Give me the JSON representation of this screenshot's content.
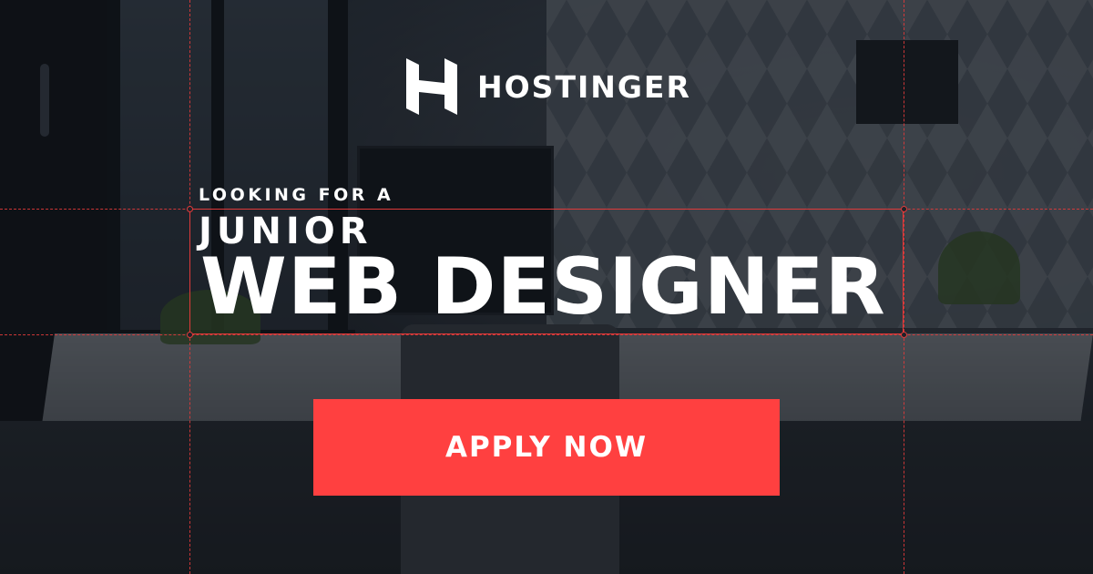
{
  "brand": {
    "name": "HOSTINGER",
    "logo_icon": "hostinger-h-icon"
  },
  "headline": {
    "kicker": "LOOKING FOR A",
    "line1": "JUNIOR",
    "line2": "WEB DESIGNER"
  },
  "cta": {
    "label": "APPLY NOW"
  },
  "colors": {
    "accent": "#ff4040",
    "guide": "#e03a3a",
    "text": "#ffffff"
  }
}
